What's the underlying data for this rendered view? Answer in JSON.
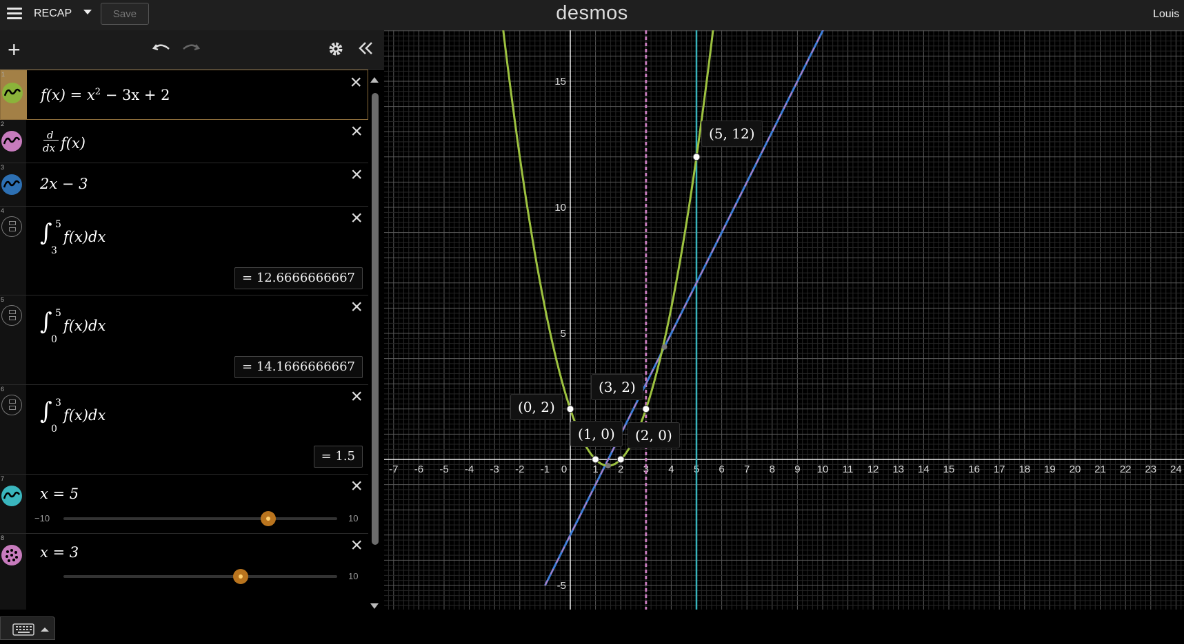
{
  "topbar": {
    "graph_title": "RECAP",
    "save_label": "Save",
    "logo": "desmos",
    "user": "Louis"
  },
  "expressions": [
    {
      "num": "1",
      "color": "#8bb33a",
      "icon": "wave-icon",
      "parts": [
        "f(x) = x",
        "2",
        " − 3x + 2"
      ]
    },
    {
      "num": "2",
      "color": "#c77bbd",
      "icon": "wave-icon",
      "parts": [
        "d",
        "dx",
        "f(x)"
      ]
    },
    {
      "num": "3",
      "color": "#2d70b3",
      "icon": "wave-icon",
      "text": "2x − 3"
    },
    {
      "num": "4",
      "icon": "fraction-icon",
      "lower": "3",
      "upper": "5",
      "integrand": "f(x)dx",
      "result": "= 12.6666666667"
    },
    {
      "num": "5",
      "icon": "fraction-icon",
      "lower": "0",
      "upper": "5",
      "integrand": "f(x)dx",
      "result": "= 14.1666666667"
    },
    {
      "num": "6",
      "icon": "fraction-icon",
      "lower": "0",
      "upper": "3",
      "integrand": "f(x)dx",
      "result": "= 1.5"
    },
    {
      "num": "7",
      "color": "#3ab6be",
      "icon": "wave-icon",
      "text": "x = 5",
      "slider": {
        "min": "−10",
        "max": "10",
        "value": 5
      }
    },
    {
      "num": "8",
      "color": "#c77bbd",
      "icon": "dots-icon",
      "text": "x = 3",
      "slider": {
        "max": "10",
        "value": 3
      }
    }
  ],
  "graph": {
    "x_ticks": [
      "-7",
      "-6",
      "-5",
      "-4",
      "-3",
      "-2",
      "-1",
      "0",
      "1",
      "2",
      "3",
      "4",
      "5",
      "6",
      "7",
      "8",
      "9",
      "10",
      "11",
      "12",
      "13",
      "14",
      "15",
      "16",
      "17",
      "18",
      "19",
      "20",
      "21",
      "22",
      "23",
      "24"
    ],
    "y_ticks": [
      "15",
      "10",
      "5",
      "-5"
    ],
    "point_labels": [
      "(0, 2)",
      "(1, 0)",
      "(2, 0)",
      "(3, 2)",
      "(5, 12)"
    ],
    "colors": {
      "parabola": "#9dc240",
      "tangent": "#3c7dd8",
      "tangent_overlay": "#c77bbd",
      "vertical_5": "#38b4bc",
      "vertical_3": "#c77bbd"
    }
  }
}
